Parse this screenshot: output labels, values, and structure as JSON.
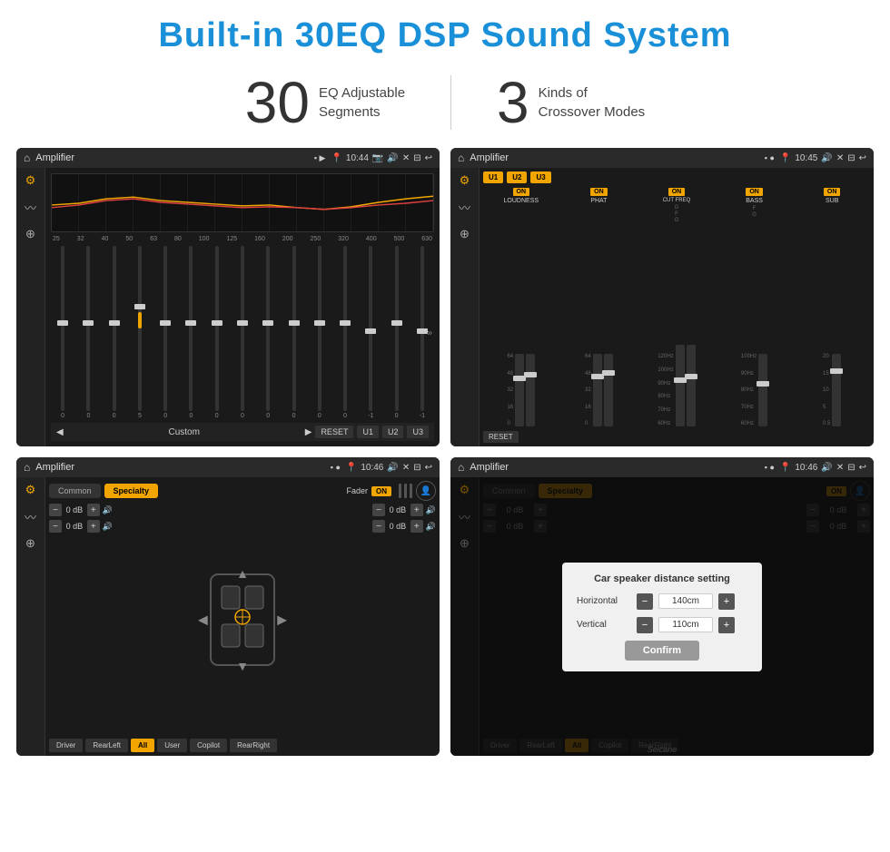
{
  "page": {
    "title": "Built-in 30EQ DSP Sound System",
    "stat1_number": "30",
    "stat1_label_line1": "EQ Adjustable",
    "stat1_label_line2": "Segments",
    "stat2_number": "3",
    "stat2_label_line1": "Kinds of",
    "stat2_label_line2": "Crossover Modes"
  },
  "screen1": {
    "title": "Amplifier",
    "time": "10:44",
    "eq_labels": [
      "25",
      "32",
      "40",
      "50",
      "63",
      "80",
      "100",
      "125",
      "160",
      "200",
      "250",
      "320",
      "400",
      "500",
      "630"
    ],
    "eq_values": [
      "0",
      "0",
      "0",
      "5",
      "0",
      "0",
      "0",
      "0",
      "0",
      "0",
      "0",
      "0",
      "-1",
      "0",
      "-1"
    ],
    "preset": "Custom",
    "buttons": [
      "RESET",
      "U1",
      "U2",
      "U3"
    ]
  },
  "screen2": {
    "title": "Amplifier",
    "time": "10:45",
    "presets": [
      "U1",
      "U2",
      "U3"
    ],
    "channels": [
      "LOUDNESS",
      "PHAT",
      "CUT FREQ",
      "BASS",
      "SUB"
    ],
    "channel_states": [
      "ON",
      "ON",
      "ON",
      "ON",
      "ON"
    ],
    "reset_label": "RESET"
  },
  "screen3": {
    "title": "Amplifier",
    "time": "10:46",
    "tabs": [
      "Common",
      "Specialty"
    ],
    "active_tab": "Specialty",
    "fader_label": "Fader",
    "fader_state": "ON",
    "db_rows": [
      {
        "value": "0 dB"
      },
      {
        "value": "0 dB"
      },
      {
        "value": "0 dB"
      },
      {
        "value": "0 dB"
      }
    ],
    "footer_btns": [
      "Driver",
      "RearLeft",
      "All",
      "User",
      "Copilot",
      "RearRight"
    ],
    "active_footer": "All"
  },
  "screen4": {
    "title": "Amplifier",
    "time": "10:46",
    "tabs": [
      "Common",
      "Specialty"
    ],
    "dialog": {
      "title": "Car speaker distance setting",
      "horizontal_label": "Horizontal",
      "horizontal_value": "140cm",
      "vertical_label": "Vertical",
      "vertical_value": "110cm",
      "confirm_label": "Confirm"
    },
    "db_rows": [
      {
        "value": "0 dB"
      },
      {
        "value": "0 dB"
      }
    ],
    "footer_btns": [
      "Driver",
      "RearLeft",
      "All",
      "Copilot",
      "RearRight"
    ]
  },
  "watermark": "Seicane"
}
